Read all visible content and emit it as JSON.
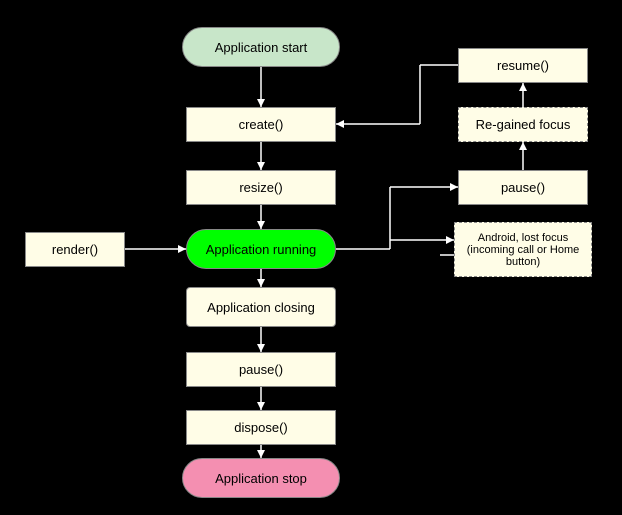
{
  "nodes": {
    "app_start": "Application start",
    "app_stop": "Application stop",
    "app_running": "Application running",
    "create": "create()",
    "resize": "resize()",
    "closing": "Application closing",
    "pause_left": "pause()",
    "dispose": "dispose()",
    "render": "render()",
    "resume": "resume()",
    "regained": "Re-gained focus",
    "pause_right": "pause()",
    "android": "Android, lost focus (incoming call or Home button)"
  }
}
